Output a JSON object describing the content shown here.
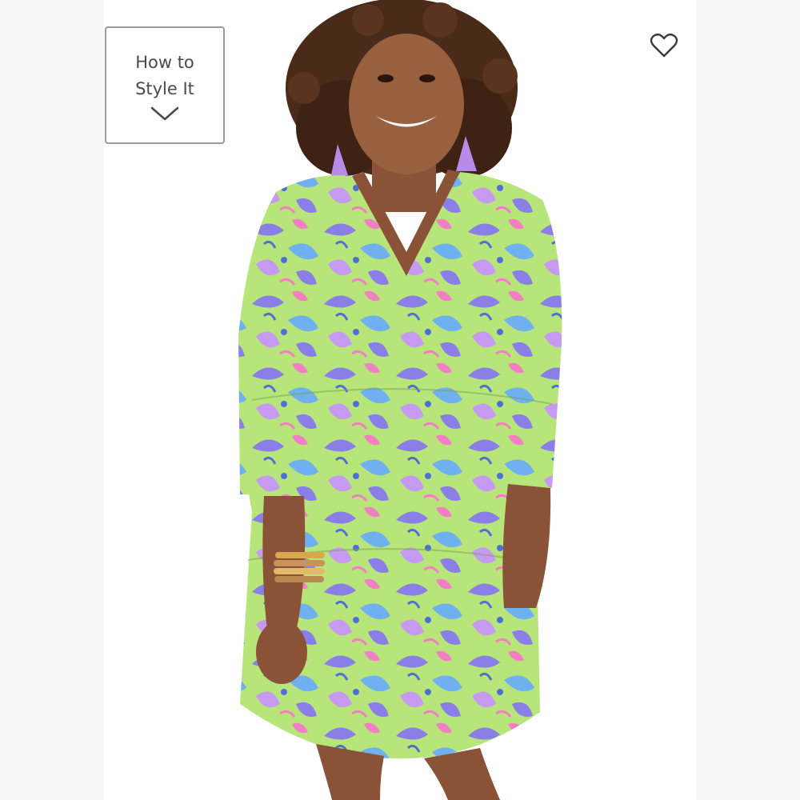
{
  "style_it": {
    "label": "How to\nStyle It",
    "icon": "chevron-down-icon"
  },
  "favorite": {
    "icon": "heart-outline-icon"
  },
  "product_photo": {
    "dress_colors": [
      "#b7e57a",
      "#8a7fe6",
      "#6fb1f0",
      "#f27fc4",
      "#c79af2"
    ]
  }
}
